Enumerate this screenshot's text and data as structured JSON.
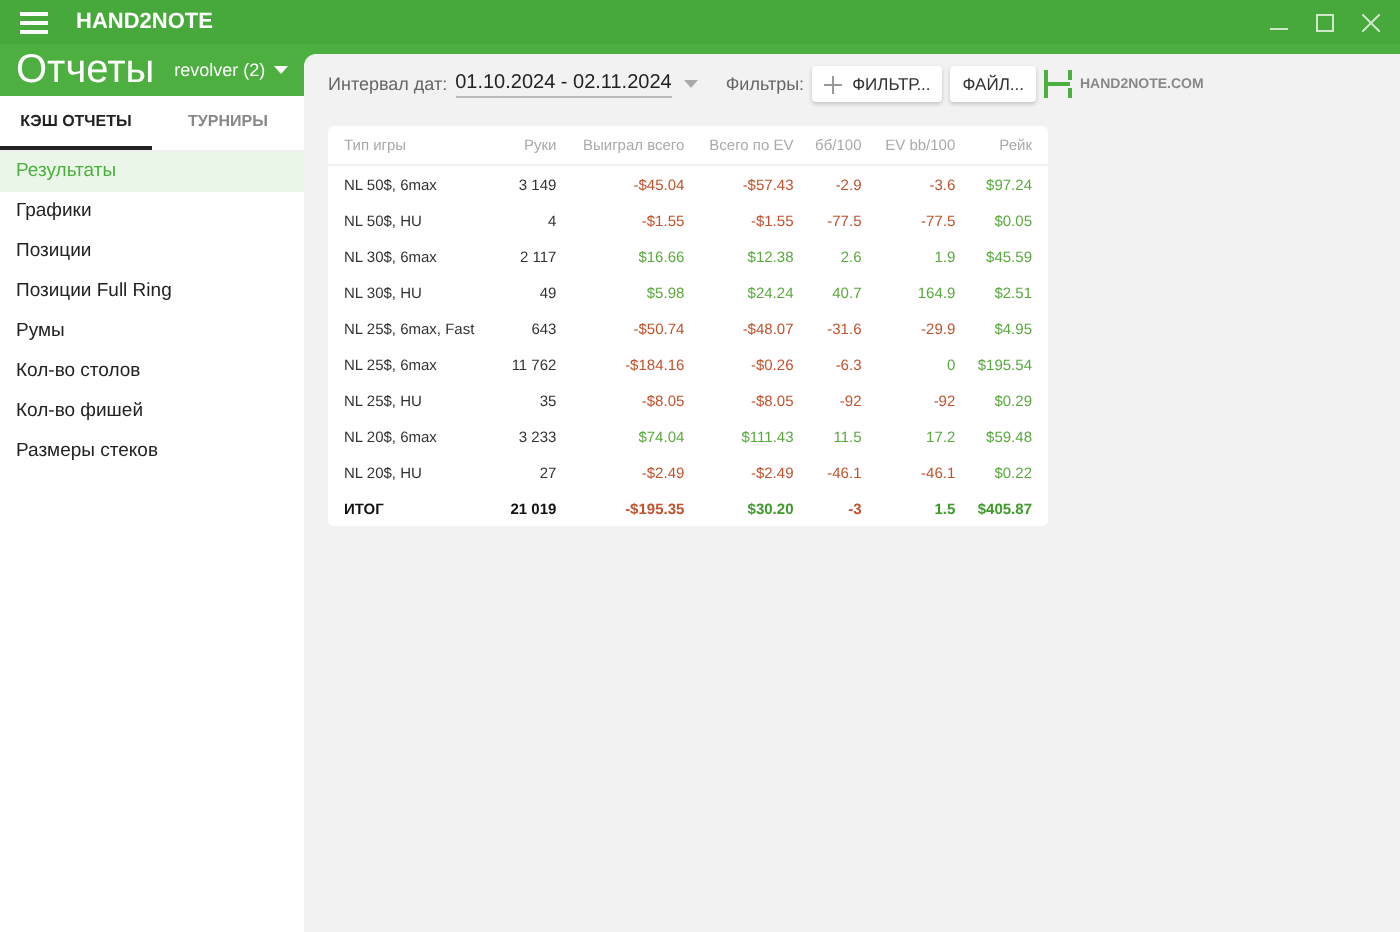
{
  "app": {
    "title": "HAND2NOTE"
  },
  "header": {
    "title": "Отчеты",
    "profile": "revolver (2)"
  },
  "tabs": [
    {
      "label": "КЭШ ОТЧЕТЫ",
      "selected": true
    },
    {
      "label": "ТУРНИРЫ",
      "selected": false
    }
  ],
  "sidebar": {
    "items": [
      {
        "label": "Результаты",
        "selected": true
      },
      {
        "label": "Графики",
        "selected": false
      },
      {
        "label": "Позиции",
        "selected": false
      },
      {
        "label": "Позиции Full Ring",
        "selected": false
      },
      {
        "label": "Румы",
        "selected": false
      },
      {
        "label": "Кол-во столов",
        "selected": false
      },
      {
        "label": "Кол-во фишей",
        "selected": false
      },
      {
        "label": "Размеры стеков",
        "selected": false
      }
    ]
  },
  "toolbar": {
    "date_label": "Интервал дат:",
    "date_range": "01.10.2024 - 02.11.2024",
    "filters_label": "Фильтры:",
    "filter_button": "ФИЛЬТР...",
    "file_button": "ФАЙЛ...",
    "logo_text": "HAND2NOTE.COM"
  },
  "table": {
    "columns": [
      "Тип игры",
      "Руки",
      "Выиграл всего",
      "Всего по EV",
      "бб/100",
      "EV bb/100",
      "Рейк"
    ],
    "rows": [
      {
        "total": false,
        "cells": [
          {
            "text": "NL 50$, 6max"
          },
          {
            "text": "3 149"
          },
          {
            "text": "-$45.04",
            "loss": true
          },
          {
            "text": "-$57.43",
            "loss": true
          },
          {
            "text": "-2.9",
            "loss": true
          },
          {
            "text": "-3.6",
            "loss": true
          },
          {
            "text": "$97.24",
            "loss": false
          }
        ]
      },
      {
        "total": false,
        "cells": [
          {
            "text": "NL 50$, HU"
          },
          {
            "text": "4"
          },
          {
            "text": "-$1.55",
            "loss": true
          },
          {
            "text": "-$1.55",
            "loss": true
          },
          {
            "text": "-77.5",
            "loss": true
          },
          {
            "text": "-77.5",
            "loss": true
          },
          {
            "text": "$0.05",
            "loss": false
          }
        ]
      },
      {
        "total": false,
        "cells": [
          {
            "text": "NL 30$, 6max"
          },
          {
            "text": "2 117"
          },
          {
            "text": "$16.66",
            "loss": false
          },
          {
            "text": "$12.38",
            "loss": false
          },
          {
            "text": "2.6",
            "loss": false
          },
          {
            "text": "1.9",
            "loss": false
          },
          {
            "text": "$45.59",
            "loss": false
          }
        ]
      },
      {
        "total": false,
        "cells": [
          {
            "text": "NL 30$, HU"
          },
          {
            "text": "49"
          },
          {
            "text": "$5.98",
            "loss": false
          },
          {
            "text": "$24.24",
            "loss": false
          },
          {
            "text": "40.7",
            "loss": false
          },
          {
            "text": "164.9",
            "loss": false
          },
          {
            "text": "$2.51",
            "loss": false
          }
        ]
      },
      {
        "total": false,
        "cells": [
          {
            "text": "NL 25$, 6max, Fast"
          },
          {
            "text": "643"
          },
          {
            "text": "-$50.74",
            "loss": true
          },
          {
            "text": "-$48.07",
            "loss": true
          },
          {
            "text": "-31.6",
            "loss": true
          },
          {
            "text": "-29.9",
            "loss": true
          },
          {
            "text": "$4.95",
            "loss": false
          }
        ]
      },
      {
        "total": false,
        "cells": [
          {
            "text": "NL 25$, 6max"
          },
          {
            "text": "11 762"
          },
          {
            "text": "-$184.16",
            "loss": true
          },
          {
            "text": "-$0.26",
            "loss": true
          },
          {
            "text": "-6.3",
            "loss": true
          },
          {
            "text": "0",
            "loss": false
          },
          {
            "text": "$195.54",
            "loss": false
          }
        ]
      },
      {
        "total": false,
        "cells": [
          {
            "text": "NL 25$, HU"
          },
          {
            "text": "35"
          },
          {
            "text": "-$8.05",
            "loss": true
          },
          {
            "text": "-$8.05",
            "loss": true
          },
          {
            "text": "-92",
            "loss": true
          },
          {
            "text": "-92",
            "loss": true
          },
          {
            "text": "$0.29",
            "loss": false
          }
        ]
      },
      {
        "total": false,
        "cells": [
          {
            "text": "NL 20$, 6max"
          },
          {
            "text": "3 233"
          },
          {
            "text": "$74.04",
            "loss": false
          },
          {
            "text": "$111.43",
            "loss": false
          },
          {
            "text": "11.5",
            "loss": false
          },
          {
            "text": "17.2",
            "loss": false
          },
          {
            "text": "$59.48",
            "loss": false
          }
        ]
      },
      {
        "total": false,
        "cells": [
          {
            "text": "NL 20$, HU"
          },
          {
            "text": "27"
          },
          {
            "text": "-$2.49",
            "loss": true
          },
          {
            "text": "-$2.49",
            "loss": true
          },
          {
            "text": "-46.1",
            "loss": true
          },
          {
            "text": "-46.1",
            "loss": true
          },
          {
            "text": "$0.22",
            "loss": false
          }
        ]
      },
      {
        "total": true,
        "cells": [
          {
            "text": "ИТОГ"
          },
          {
            "text": "21 019"
          },
          {
            "text": "-$195.35",
            "loss": true
          },
          {
            "text": "$30.20",
            "loss": false
          },
          {
            "text": "-3",
            "loss": true
          },
          {
            "text": "1.5",
            "loss": false
          },
          {
            "text": "$405.87",
            "loss": false
          }
        ]
      }
    ]
  }
}
